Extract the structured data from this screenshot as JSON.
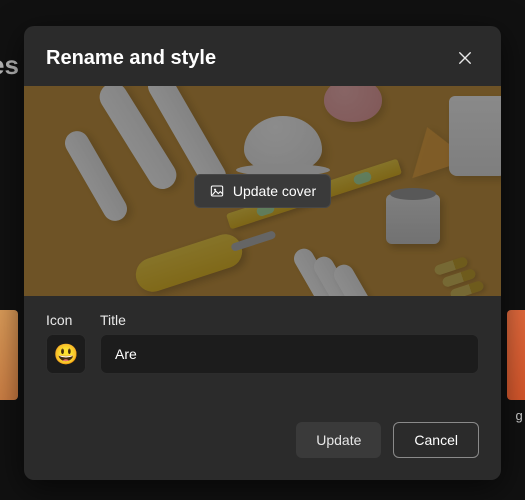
{
  "background": {
    "heading_fragment": "es",
    "right_label_fragment": "g S"
  },
  "modal": {
    "title": "Rename and style",
    "cover": {
      "update_button_label": "Update cover"
    },
    "form": {
      "icon_label": "Icon",
      "title_label": "Title",
      "icon_emoji": "😃",
      "title_value": "Are"
    },
    "footer": {
      "update_label": "Update",
      "cancel_label": "Cancel"
    }
  }
}
